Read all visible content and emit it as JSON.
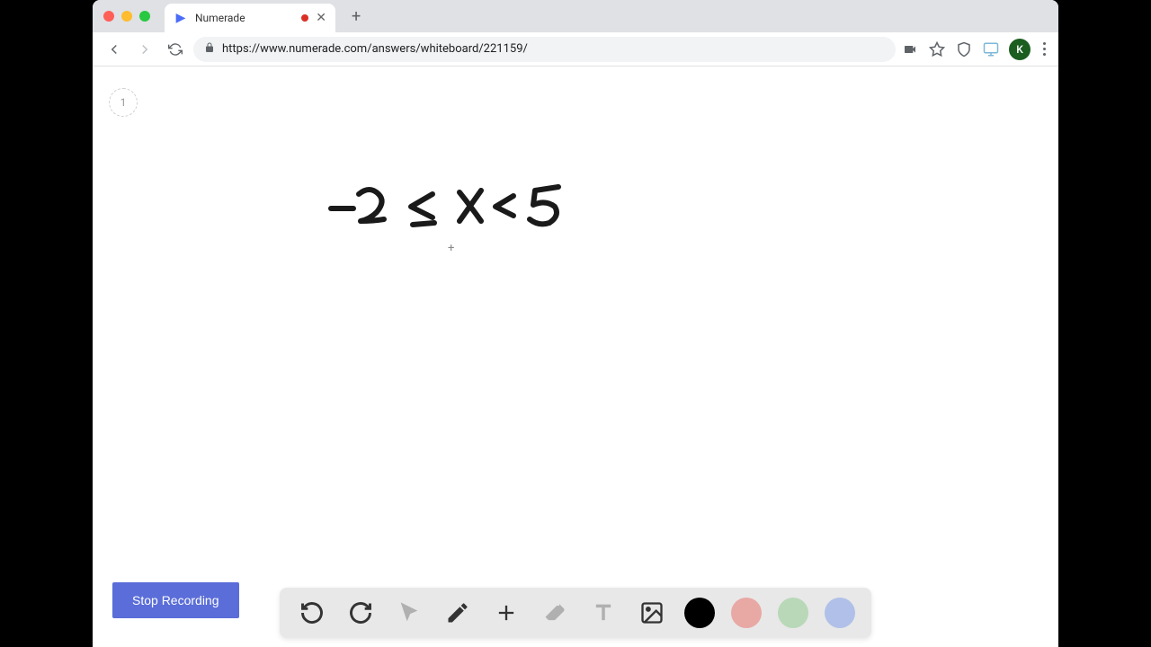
{
  "tab": {
    "title": "Numerade"
  },
  "url": "https://www.numerade.com/answers/whiteboard/221159/",
  "avatar_letter": "K",
  "page_number": "1",
  "handwritten_expression": "-2 ≤ x < 5",
  "stop_button_label": "Stop Recording",
  "toolbar": {
    "undo": "undo",
    "redo": "redo",
    "pointer": "pointer",
    "pen": "pen",
    "add": "add",
    "eraser": "eraser",
    "text": "text",
    "image": "image"
  },
  "colors": {
    "black": "#000000",
    "pink": "#e8a8a4",
    "green": "#b8d8b8",
    "blue": "#b0c0e8"
  }
}
